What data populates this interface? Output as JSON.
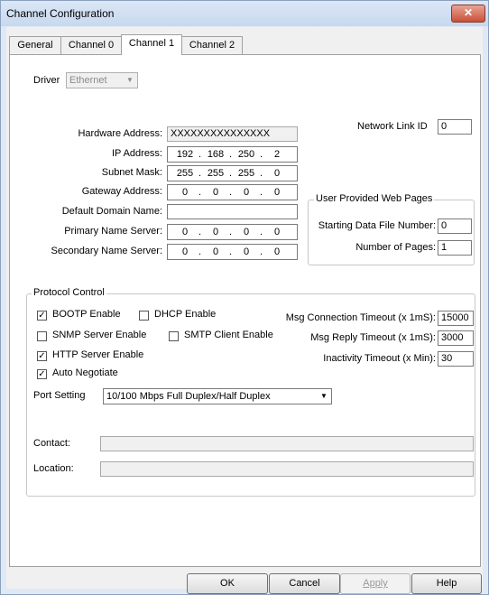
{
  "window": {
    "title": "Channel Configuration",
    "close_icon": "close-icon"
  },
  "tabs": [
    "General",
    "Channel 0",
    "Channel 1",
    "Channel 2"
  ],
  "driver": {
    "label": "Driver",
    "value": "Ethernet"
  },
  "network_link_id": {
    "label": "Network Link ID",
    "value": "0"
  },
  "hardware_address": {
    "label": "Hardware Address:",
    "value": "XXXXXXXXXXXXXXX"
  },
  "ip_address": {
    "label": "IP Address:",
    "octets": [
      "192",
      "168",
      "250",
      "2"
    ]
  },
  "subnet_mask": {
    "label": "Subnet Mask:",
    "octets": [
      "255",
      "255",
      "255",
      "0"
    ]
  },
  "gateway_address": {
    "label": "Gateway Address:",
    "octets": [
      "0",
      "0",
      "0",
      "0"
    ]
  },
  "default_domain_name": {
    "label": "Default Domain Name:",
    "value": ""
  },
  "primary_name_server": {
    "label": "Primary Name Server:",
    "octets": [
      "0",
      "0",
      "0",
      "0"
    ]
  },
  "secondary_name_server": {
    "label": "Secondary Name Server:",
    "octets": [
      "0",
      "0",
      "0",
      "0"
    ]
  },
  "web_pages": {
    "title": "User Provided Web Pages",
    "starting_label": "Starting Data File Number:",
    "starting_value": "0",
    "pages_label": "Number of Pages:",
    "pages_value": "1"
  },
  "protocol": {
    "title": "Protocol Control",
    "bootp": {
      "label": "BOOTP Enable",
      "checked": "✓"
    },
    "dhcp": {
      "label": "DHCP Enable",
      "checked": ""
    },
    "snmp": {
      "label": "SNMP Server Enable",
      "checked": ""
    },
    "smtp": {
      "label": "SMTP Client Enable",
      "checked": ""
    },
    "http": {
      "label": "HTTP Server Enable",
      "checked": "✓"
    },
    "autoneg": {
      "label": "Auto Negotiate",
      "checked": "✓"
    },
    "msg_conn_timeout": {
      "label": "Msg Connection Timeout (x 1mS):",
      "value": "15000"
    },
    "msg_reply_timeout": {
      "label": "Msg Reply Timeout (x 1mS):",
      "value": "3000"
    },
    "inactivity_timeout": {
      "label": "Inactivity Timeout (x Min):",
      "value": "30"
    },
    "port_setting": {
      "label": "Port Setting",
      "value": "10/100 Mbps Full Duplex/Half Duplex"
    },
    "contact": {
      "label": "Contact:",
      "value": ""
    },
    "location": {
      "label": "Location:",
      "value": ""
    }
  },
  "buttons": {
    "ok": "OK",
    "cancel": "Cancel",
    "apply": "Apply",
    "help": "Help"
  }
}
